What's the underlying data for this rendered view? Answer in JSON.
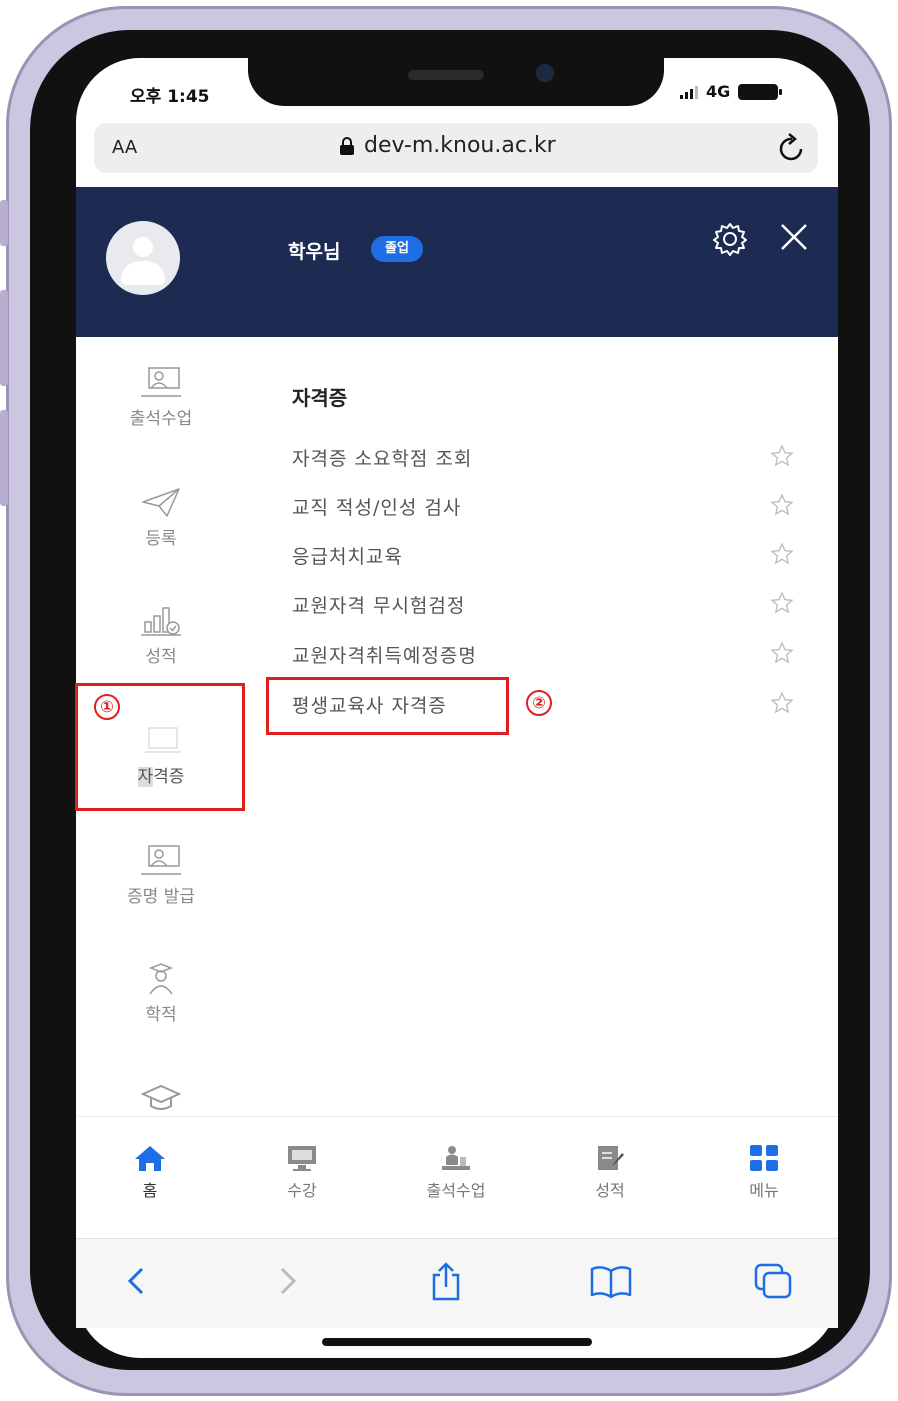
{
  "status_bar": {
    "time": "오후 1:45",
    "network": "4G"
  },
  "browser": {
    "text_size": "AA",
    "url": "dev-m.knou.ac.kr"
  },
  "header": {
    "user_name": "학우님",
    "badge": "졸업"
  },
  "side_menu": {
    "items": [
      {
        "label": "출석수업"
      },
      {
        "label": "등록"
      },
      {
        "label": "성적"
      },
      {
        "label_first_char": "자",
        "label_rest": "격증"
      },
      {
        "label": "증명 발급"
      },
      {
        "label": "학적"
      }
    ]
  },
  "content": {
    "section_title": "자격증",
    "items": [
      {
        "label": "자격증 소요학점 조회"
      },
      {
        "label": "교직 적성/인성 검사"
      },
      {
        "label": "응급처치교육"
      },
      {
        "label": "교원자격 무시험검정"
      },
      {
        "label": "교원자격취득예정증명"
      },
      {
        "label": "평생교육사 자격증"
      }
    ]
  },
  "annotations": {
    "marker_1": "①",
    "marker_2": "②",
    "color": "#e02020"
  },
  "tab_bar": {
    "items": [
      {
        "label": "홈"
      },
      {
        "label": "수강"
      },
      {
        "label": "출석수업"
      },
      {
        "label": "성적"
      },
      {
        "label": "메뉴"
      }
    ]
  },
  "colors": {
    "header_bg": "#1d2b53",
    "accent": "#1e6fe6"
  }
}
